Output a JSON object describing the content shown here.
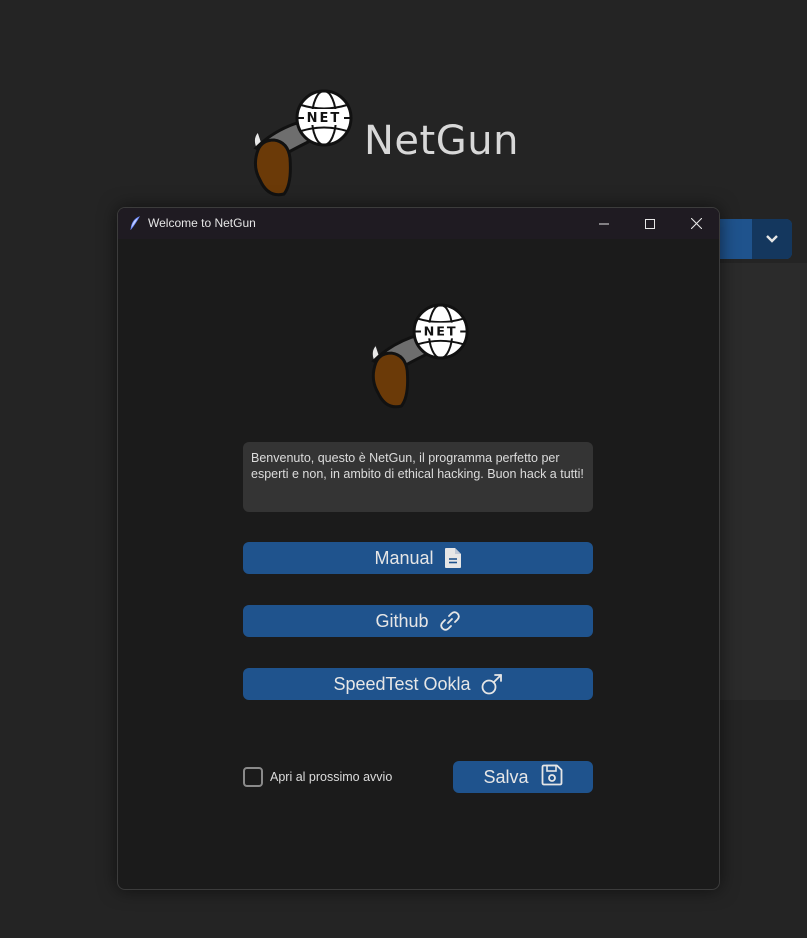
{
  "app": {
    "title": "NetGun",
    "logo_text": "NET",
    "logo_icon": "netgun-logo"
  },
  "dialog": {
    "window_title": "Welcome to NetGun",
    "window_icon": "feather-icon",
    "controls": [
      "minimize-icon",
      "maximize-icon",
      "close-icon"
    ],
    "message": "Benvenuto, questo è NetGun, il programma perfetto per esperti e non, in ambito di ethical hacking. Buon hack a tutti!",
    "buttons": {
      "manual": {
        "label": "Manual",
        "icon": "document-icon"
      },
      "github": {
        "label": "Github",
        "icon": "link-icon"
      },
      "speedtest": {
        "label": "SpeedTest Ookla",
        "icon": "external-link-icon"
      }
    },
    "checkbox": {
      "label": "Apri al prossimo avvio",
      "checked": false
    },
    "save": {
      "label": "Salva",
      "icon": "save-icon"
    }
  },
  "colors": {
    "background": "#242424",
    "dialog_bg": "#1b1b1b",
    "button": "#1f538d",
    "button_dark": "#14375e",
    "textbox": "#343434"
  }
}
